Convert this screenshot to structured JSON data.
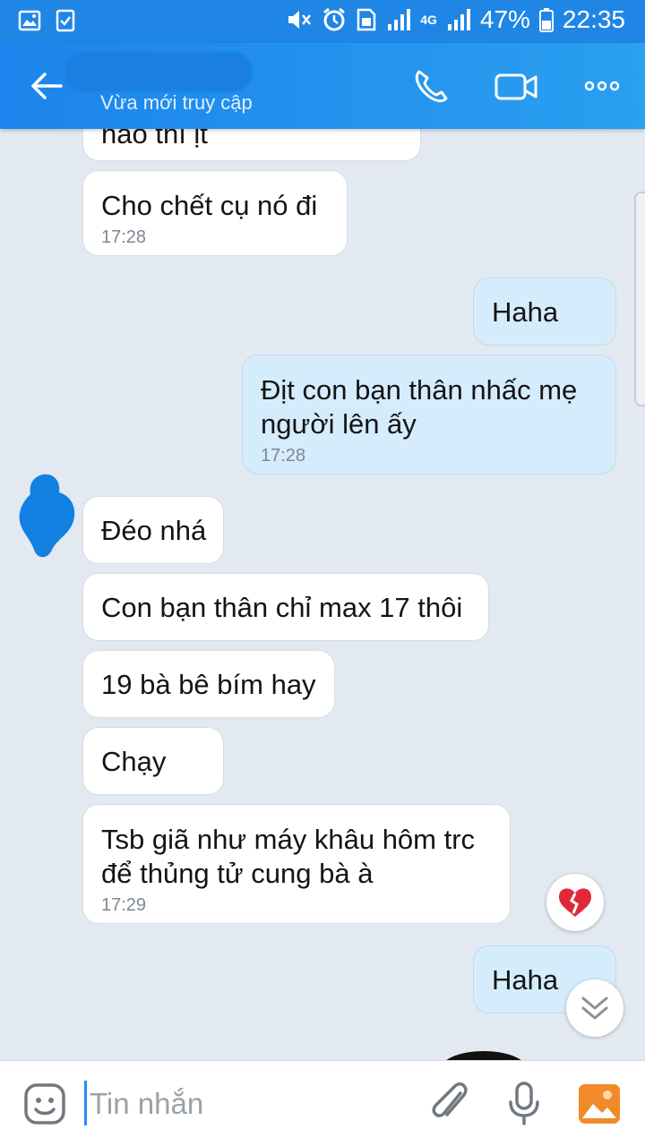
{
  "status_bar": {
    "battery": "47%",
    "time": "22:35",
    "network": "4G"
  },
  "header": {
    "subtitle": "Vừa mới truy cập"
  },
  "messages": [
    {
      "side": "in",
      "text": "nào thì ịt",
      "time": ""
    },
    {
      "side": "in",
      "text": "Cho chết cụ nó đi",
      "time": "17:28"
    },
    {
      "side": "out",
      "text": "Haha",
      "time": ""
    },
    {
      "side": "out",
      "text": "Địt con bạn thân nhấc mẹ người lên ấy",
      "time": "17:28"
    },
    {
      "side": "in",
      "text": "Đéo nhá",
      "time": ""
    },
    {
      "side": "in",
      "text": "Con bạn thân chỉ max 17 thôi",
      "time": ""
    },
    {
      "side": "in",
      "text": "19 bà bê bím hay",
      "time": ""
    },
    {
      "side": "in",
      "text": "Chạy",
      "time": ""
    },
    {
      "side": "in",
      "text": "Tsb giã như máy khâu hôm trc để thủng tử cung bà à",
      "time": "17:29"
    },
    {
      "side": "out",
      "text": "Haha",
      "time": ""
    }
  ],
  "input": {
    "placeholder": "Tin nhắn"
  },
  "icons": {
    "back": "back-arrow-icon",
    "call": "phone-icon",
    "video": "video-camera-icon",
    "more": "more-icon",
    "reaction": "broken-heart-icon",
    "scroll_down": "chevron-double-down-icon",
    "emoji": "emoji-icon",
    "attach": "paperclip-icon",
    "mic": "microphone-icon",
    "gallery": "gallery-icon"
  },
  "colors": {
    "header": "#1f86e6",
    "outgoing_bubble": "#d5ecfd",
    "incoming_bubble": "#ffffff",
    "background": "#e2e9f1"
  }
}
